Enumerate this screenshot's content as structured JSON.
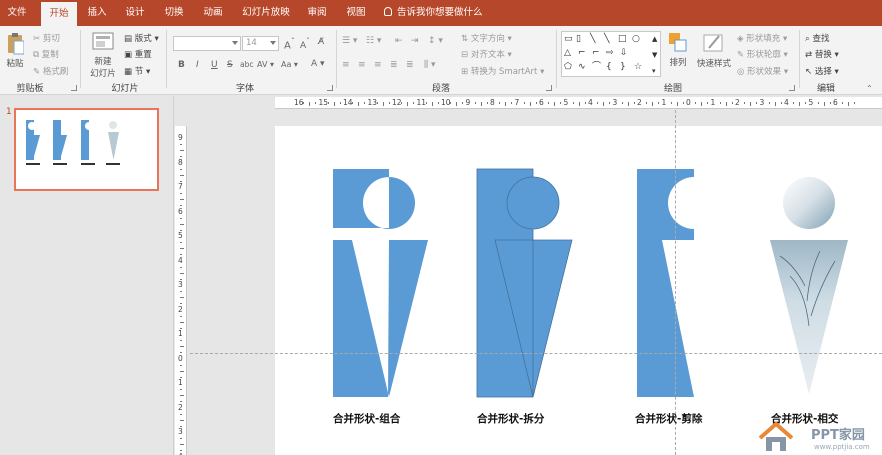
{
  "tabs": [
    {
      "label": "文件",
      "active": false
    },
    {
      "label": "开始",
      "active": true
    },
    {
      "label": "插入",
      "active": false
    },
    {
      "label": "设计",
      "active": false
    },
    {
      "label": "切换",
      "active": false
    },
    {
      "label": "动画",
      "active": false
    },
    {
      "label": "幻灯片放映",
      "active": false
    },
    {
      "label": "审阅",
      "active": false
    },
    {
      "label": "视图",
      "active": false
    }
  ],
  "tell_me": "告诉我你想要做什么",
  "ribbon": {
    "clipboard": {
      "paste": "粘贴",
      "cut": "剪切",
      "copy": "复制",
      "format_painter": "格式刷",
      "label": "剪贴板"
    },
    "slides": {
      "new_slide_1": "新建",
      "new_slide_2": "幻灯片",
      "layout": "版式",
      "reset": "重置",
      "section": "节",
      "label": "幻灯片"
    },
    "font": {
      "font_name": "",
      "font_size": "14",
      "bold": "B",
      "italic": "I",
      "underline": "U",
      "strike": "S",
      "shadow": "abc",
      "spacing": "AV",
      "case": "Aa",
      "color": "A",
      "label": "字体"
    },
    "paragraph": {
      "text_direction": "文字方向",
      "align_text": "对齐文本",
      "smartart": "转换为 SmartArt",
      "label": "段落"
    },
    "drawing": {
      "arrange": "排列",
      "quick_styles": "快速样式",
      "fill": "形状填充",
      "outline": "形状轮廓",
      "effects": "形状效果",
      "label": "绘图"
    },
    "editing": {
      "find": "查找",
      "replace": "替换",
      "select": "选择",
      "label": "编辑"
    }
  },
  "colors": {
    "accent": "#b7472a",
    "shape_blue": "#5b9bd5",
    "shape_stroke": "#41719c"
  },
  "slide_number": "1",
  "hruler_labels": [
    "16",
    "15",
    "14",
    "13",
    "12",
    "11",
    "10",
    "9",
    "8",
    "7",
    "6",
    "5",
    "4",
    "3",
    "2",
    "1",
    "0",
    "1",
    "2",
    "3",
    "4",
    "5",
    "6"
  ],
  "vruler_labels": [
    "9",
    "8",
    "7",
    "6",
    "5",
    "4",
    "3",
    "2",
    "1",
    "0",
    "1",
    "2",
    "3",
    "4"
  ],
  "captions": [
    "合并形状-组合",
    "合并形状-拆分",
    "合并形状-剪除",
    "合并形状-相交"
  ],
  "watermark": {
    "brand": "PPT家园",
    "url": "www.pptjia.com"
  }
}
